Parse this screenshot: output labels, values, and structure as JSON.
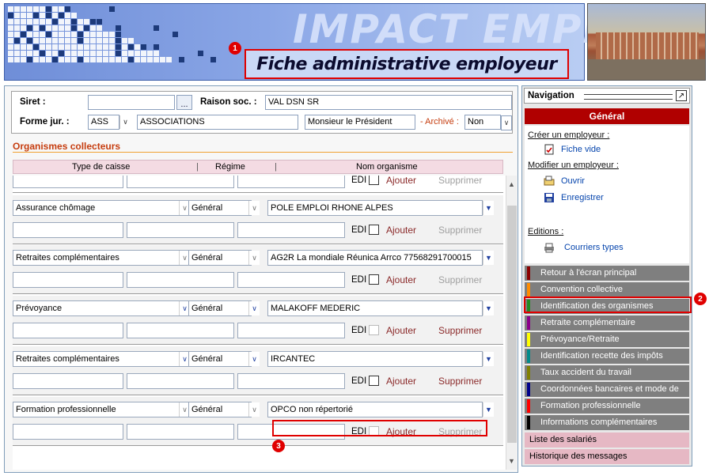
{
  "header": {
    "banner_word": "IMPACT EMPLOI",
    "title": "Fiche administrative employeur",
    "badges": [
      "1",
      "2",
      "3"
    ]
  },
  "form": {
    "siret_label": "Siret :",
    "siret_value": "",
    "ellipsis": "...",
    "raison_label": "Raison soc. :",
    "raison_value": "VAL DSN SR",
    "forme_label": "Forme jur. :",
    "forme_code": "ASS",
    "forme_value": "ASSOCIATIONS",
    "representant": "Monsieur le Président",
    "archive_label": "- Archivé :",
    "archive_value": "Non"
  },
  "section": {
    "title": "Organismes collecteurs",
    "col_type": "Type de caisse",
    "col_regime": "Régime",
    "col_nom": "Nom organisme"
  },
  "row_actions": {
    "edi": "EDI",
    "ajouter": "Ajouter",
    "supprimer": "Supprimer"
  },
  "organismes": [
    {
      "type": "Assurance chômage",
      "regime": "Général",
      "nom": "POLE EMPLOI RHONE ALPES"
    },
    {
      "type": "Retraites complémentaires",
      "regime": "Général",
      "nom": "AG2R La mondiale Réunica Arrco 77568291700015"
    },
    {
      "type": "Prévoyance",
      "regime": "Général",
      "nom": "MALAKOFF MEDERIC"
    },
    {
      "type": "Retraites complémentaires",
      "regime": "Général",
      "nom": "IRCANTEC"
    },
    {
      "type": "Formation professionnelle",
      "regime": "Général",
      "nom": "OPCO non répertorié"
    }
  ],
  "nav": {
    "title": "Navigation",
    "tab": "Général",
    "creer_label": "Créer un employeur :",
    "fiche_vide": "Fiche vide",
    "modifier_label": "Modifier un employeur :",
    "ouvrir": "Ouvrir",
    "enregistrer": "Enregistrer",
    "editions_label": "Editions :",
    "courriers": "Courriers types",
    "menu": [
      {
        "label": "Retour à l'écran principal",
        "color": "#8b0000"
      },
      {
        "label": "Convention collective",
        "color": "#ff8c00"
      },
      {
        "label": "Identification des organismes",
        "color": "#228b22"
      },
      {
        "label": "Retraite complémentaire",
        "color": "#8b008b"
      },
      {
        "label": "Prévoyance/Retraite",
        "color": "#ffff00"
      },
      {
        "label": "Identification recette des impôts",
        "color": "#008b8b"
      },
      {
        "label": "Taux accident du travail",
        "color": "#808000"
      },
      {
        "label": "Coordonnées bancaires et mode de",
        "color": "#00008b"
      },
      {
        "label": "Formation professionnelle",
        "color": "#ff0000"
      },
      {
        "label": "Informations complémentaires",
        "color": "#000000"
      }
    ],
    "liste_salaries": "Liste des salariés",
    "historique": "Historique des messages"
  }
}
